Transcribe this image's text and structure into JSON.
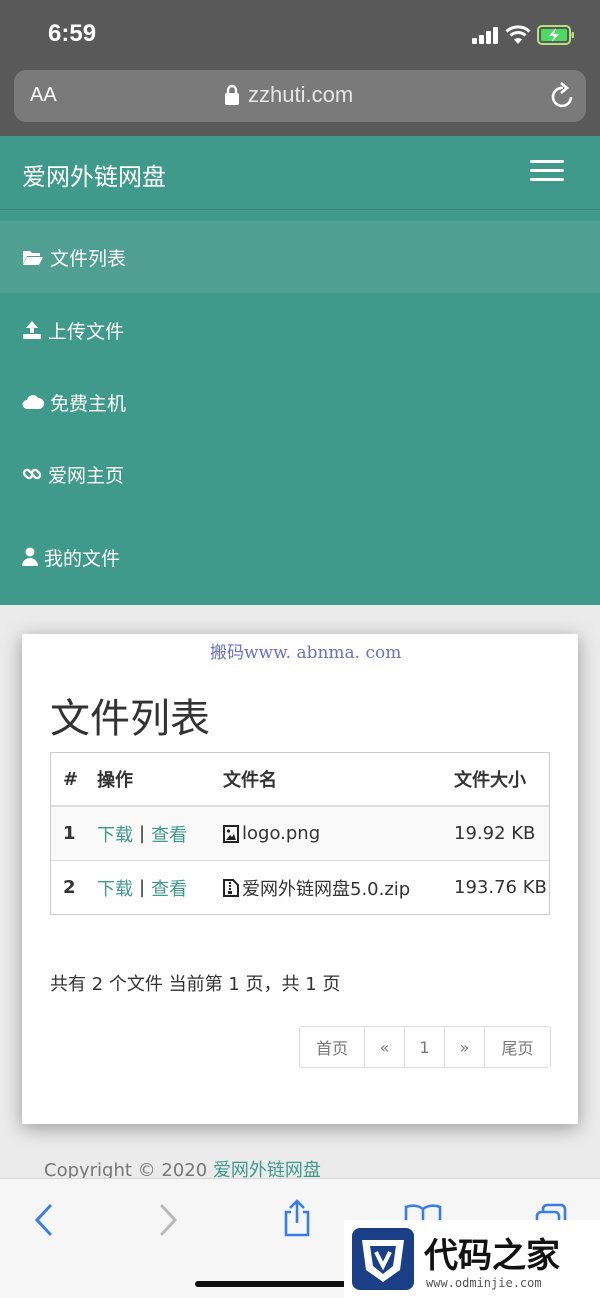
{
  "status_bar": {
    "time": "6:59"
  },
  "url_bar": {
    "aa_label": "AA",
    "url": "zzhuti.com"
  },
  "navbar": {
    "brand": "爱网外链网盘"
  },
  "menu": {
    "items": [
      {
        "label": "文件列表",
        "icon": "folder-open-icon",
        "active": true
      },
      {
        "label": "上传文件",
        "icon": "upload-icon"
      },
      {
        "label": "免费主机",
        "icon": "cloud-icon"
      },
      {
        "label": "爱网主页",
        "icon": "link-icon"
      },
      {
        "label": "我的文件",
        "icon": "user-icon"
      }
    ]
  },
  "watermark": "搬码www. abnma. com",
  "page": {
    "title": "文件列表"
  },
  "table": {
    "headers": {
      "num": "#",
      "op": "操作",
      "name": "文件名",
      "size": "文件大小"
    },
    "rows": [
      {
        "num": "1",
        "download": "下载",
        "sep": "|",
        "view": "查看",
        "name": "logo.png",
        "size": "19.92 KB",
        "icon": "image-file-icon"
      },
      {
        "num": "2",
        "download": "下载",
        "sep": "|",
        "view": "查看",
        "name": "爱网外链网盘5.0.zip",
        "size": "193.76 KB",
        "icon": "zip-file-icon"
      }
    ]
  },
  "summary": "共有 2 个文件 当前第 1 页，共 1 页",
  "pagination": {
    "first": "首页",
    "prev": "«",
    "current": "1",
    "next": "»",
    "last": "尾页"
  },
  "footer": {
    "prefix": "Copyright © 2020 ",
    "link": "爱网外链网盘"
  },
  "corner_logo": {
    "name": "代码之家",
    "url": "www.odminjie.com"
  },
  "colors": {
    "primary": "#3f9a8c",
    "active_item": "#509f93",
    "safari_blue": "#3b7ce8"
  }
}
